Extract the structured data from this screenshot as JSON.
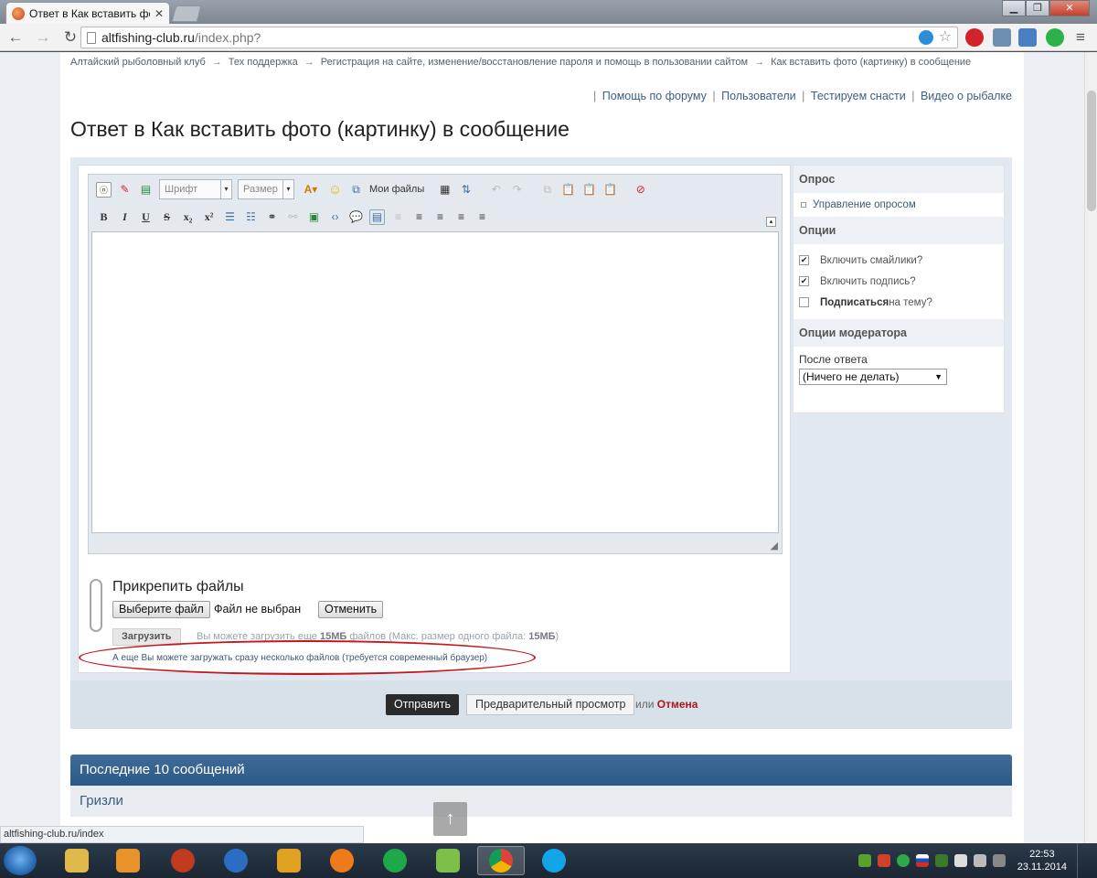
{
  "browser": {
    "tab_title": "Ответ в Как вставить фот",
    "url_host": "altfishing-club.ru",
    "url_path": "/index.php?",
    "status_url": "altfishing-club.ru/index"
  },
  "breadcrumb": {
    "items": [
      "Алтайский рыболовный клуб",
      "Тех поддержка",
      "Регистрация на сайте, изменение/восстановление пароля и помощь в пользовании сайтом",
      "Как вставить фото (картинку) в сообщение"
    ],
    "separator": "→"
  },
  "top_links": [
    "Помощь по форуму",
    "Пользователи",
    "Тестируем снасти",
    "Видео о рыбалке"
  ],
  "page_title": "Ответ в Как вставить фото (картинку) в сообщение",
  "editor": {
    "font_placeholder": "Шрифт",
    "size_placeholder": "Размер",
    "my_files": "Мои файлы",
    "bold": "B",
    "italic": "I",
    "underline": "U",
    "strike": "S",
    "sub": "x₂",
    "sup": "x²"
  },
  "attachments": {
    "title": "Прикрепить файлы",
    "choose_file": "Выберите файл",
    "no_file": "Файл не выбран",
    "cancel": "Отменить",
    "upload": "Загрузить",
    "info_prefix": "Вы можете загрузить еще ",
    "info_amount": "15МБ",
    "info_middle": " файлов (Макс. размер одного файла: ",
    "info_max": "15МБ",
    "info_suffix": ")",
    "multi_note": "А еще Вы можете загружать сразу несколько файлов (требуется современный браузер)"
  },
  "sidebar": {
    "poll_head": "Опрос",
    "poll_manage": "Управление опросом",
    "options_head": "Опции",
    "opt_smilies": "Включить смайлики?",
    "opt_signature": "Включить подпись?",
    "opt_subscribe_bold": "Подписаться",
    "opt_subscribe_rest": " на тему?",
    "mod_head": "Опции модератора",
    "after_reply_label": "После ответа",
    "after_reply_value": "(Ничего не делать)"
  },
  "submit": {
    "send": "Отправить",
    "preview": "Предварительный просмотр",
    "or": "или",
    "cancel": "Отмена"
  },
  "recent": {
    "title": "Последние 10 сообщений",
    "first_author": "Гризли"
  },
  "taskbar": {
    "time": "22:53",
    "date": "23.11.2014"
  },
  "colors": {
    "accent": "#2b5985",
    "link": "#3b5f82",
    "cancel_red": "#b2141b",
    "annotation_oval": "#c8161d"
  }
}
